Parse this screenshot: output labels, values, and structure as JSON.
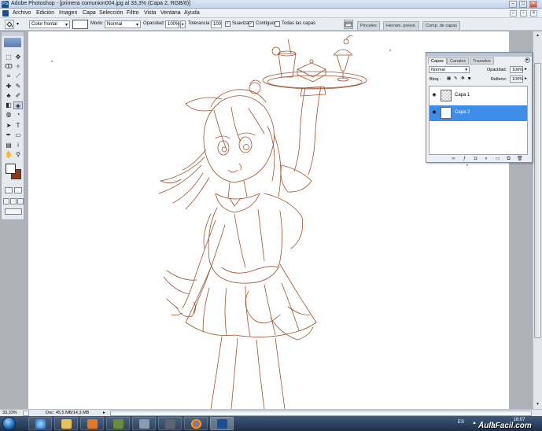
{
  "window": {
    "title": "Adobe Photoshop - [primera comunion004.jpg al 33,3% (Capa 2, RGB/8)]"
  },
  "menu": {
    "items": [
      "Archivo",
      "Edición",
      "Imagen",
      "Capa",
      "Selección",
      "Filtro",
      "Vista",
      "Ventana",
      "Ayuda"
    ]
  },
  "options": {
    "brush_preset": "Color frontal",
    "mode_label": "Modo:",
    "mode_value": "Normal",
    "opacity_label": "Opacidad:",
    "opacity_value": "100%",
    "tolerance_label": "Tolerancia:",
    "tolerance_value": "100",
    "antialias_label": "Suavizar",
    "contiguous_label": "Contiguo",
    "all_layers_label": "Todas las capas",
    "well_tabs": [
      "Pinceles",
      "Herram. preest.",
      "Comp. de capas"
    ]
  },
  "colors": {
    "foreground": "#ffffff",
    "background": "#8b3a18",
    "line_art": "#a0522d",
    "selected_layer": "#3c8ee8"
  },
  "layers_panel": {
    "tabs": [
      "Capas",
      "Canales",
      "Trazados"
    ],
    "blend_mode": "Normal",
    "opacity_label": "Opacidad:",
    "opacity_value": "100%",
    "lock_label": "Bloq.:",
    "fill_label": "Relleno:",
    "fill_value": "100%",
    "layers": [
      {
        "name": "Capa 1",
        "selected": false
      },
      {
        "name": "Capa 2",
        "selected": true
      }
    ]
  },
  "status": {
    "zoom": "33,33%",
    "doc_info": "Doc: 45,5 MB/14,3 MB"
  },
  "taskbar": {
    "language": "ES",
    "time": "18:07"
  },
  "watermark": "AulaFacil.com"
}
